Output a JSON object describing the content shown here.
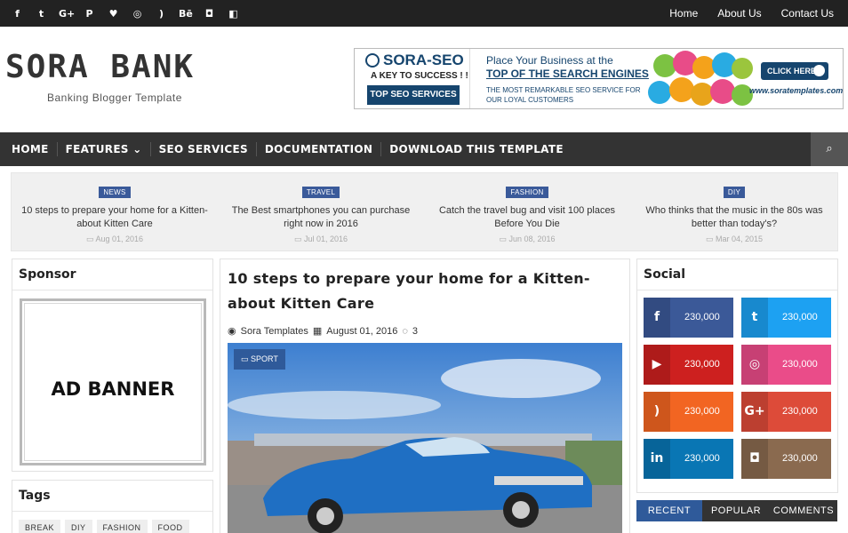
{
  "topbar": {
    "social_icons": [
      {
        "name": "facebook-icon",
        "glyph": "f"
      },
      {
        "name": "twitter-icon",
        "glyph": "t"
      },
      {
        "name": "google-plus-icon",
        "glyph": "G+"
      },
      {
        "name": "pinterest-icon",
        "glyph": "P"
      },
      {
        "name": "heart-icon",
        "glyph": "♥"
      },
      {
        "name": "dribbble-icon",
        "glyph": "◎"
      },
      {
        "name": "rss-icon",
        "glyph": ")"
      },
      {
        "name": "behance-icon",
        "glyph": "Bē"
      },
      {
        "name": "instagram-icon",
        "glyph": "◘"
      },
      {
        "name": "delicious-icon",
        "glyph": "◧"
      }
    ],
    "links": [
      "Home",
      "About Us",
      "Contact Us"
    ]
  },
  "header": {
    "logo": "SORA BANK",
    "tagline": "Banking Blogger Template"
  },
  "top_ad": {
    "brand": "SORA-SEO",
    "key": "A KEY TO SUCCESS ! !",
    "services": "TOP SEO SERVICES",
    "line1": "Place Your Business at the",
    "line2": "TOP OF THE SEARCH ENGINES",
    "line3": "THE MOST REMARKABLE SEO SERVICE FOR OUR LOYAL CUSTOMERS",
    "cta": "CLICK HERE",
    "url": "www.soratemplates.com"
  },
  "mainnav": {
    "items": [
      "HOME",
      "FEATURES",
      "SEO SERVICES",
      "DOCUMENTATION",
      "DOWNLOAD THIS TEMPLATE"
    ],
    "features_caret": "⌄",
    "search_glyph": "⌕"
  },
  "featured": [
    {
      "label": "NEWS",
      "title": "10 steps to prepare your home for a Kitten-about Kitten Care",
      "date": "Aug 01, 2016"
    },
    {
      "label": "TRAVEL",
      "title": "The Best smartphones you can purchase right now in 2016",
      "date": "Jul 01, 2016"
    },
    {
      "label": "FASHION",
      "title": "Catch the travel bug and visit 100 places Before You Die",
      "date": "Jun 08, 2016"
    },
    {
      "label": "DIY",
      "title": "Who thinks that the music in the 80s was better than today's?",
      "date": "Mar 04, 2015"
    }
  ],
  "sponsor": {
    "title": "Sponsor",
    "banner": "AD BANNER"
  },
  "tags": {
    "title": "Tags",
    "items": [
      "BREAK",
      "DIY",
      "FASHION",
      "FOOD"
    ]
  },
  "post": {
    "title": "10 steps to prepare your home for a Kitten-about Kitten Care",
    "author": "Sora Templates",
    "date": "August 01, 2016",
    "comments": "3",
    "label": "SPORT"
  },
  "social": {
    "title": "Social",
    "tiles": [
      {
        "name": "facebook",
        "glyph": "f",
        "count": "230,000",
        "color": "#3b5998"
      },
      {
        "name": "twitter",
        "glyph": "t",
        "count": "230,000",
        "color": "#1da1f2"
      },
      {
        "name": "youtube",
        "glyph": "▶",
        "count": "230,000",
        "color": "#cd201f"
      },
      {
        "name": "dribbble",
        "glyph": "◎",
        "count": "230,000",
        "color": "#ea4c89"
      },
      {
        "name": "rss",
        "glyph": ")",
        "count": "230,000",
        "color": "#f26522"
      },
      {
        "name": "google-plus",
        "glyph": "G+",
        "count": "230,000",
        "color": "#dd4b39"
      },
      {
        "name": "linkedin",
        "glyph": "in",
        "count": "230,000",
        "color": "#0976b4"
      },
      {
        "name": "instagram",
        "glyph": "◘",
        "count": "230,000",
        "color": "#8a6a4f"
      }
    ]
  },
  "tabs": [
    "RECENT",
    "POPULAR",
    "COMMENTS"
  ]
}
